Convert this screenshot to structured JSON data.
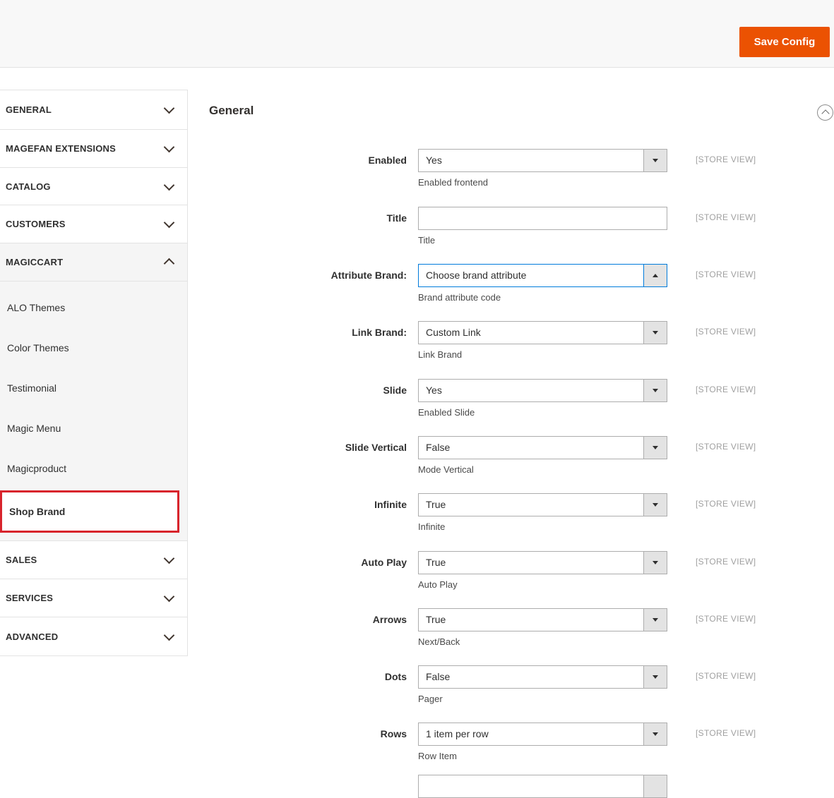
{
  "toolbar": {
    "save_label": "Save Config"
  },
  "sidebar": {
    "sections_above": [
      {
        "label": "GENERAL"
      },
      {
        "label": "MAGEFAN EXTENSIONS"
      },
      {
        "label": "CATALOG"
      },
      {
        "label": "CUSTOMERS"
      }
    ],
    "magiccart": {
      "label": "MAGICCART"
    },
    "subitems": [
      {
        "label": "ALO Themes"
      },
      {
        "label": "Color Themes"
      },
      {
        "label": "Testimonial"
      },
      {
        "label": "Magic Menu"
      },
      {
        "label": "Magicproduct"
      }
    ],
    "selected_subitem": {
      "label": "Shop Brand"
    },
    "sections_below": [
      {
        "label": "SALES"
      },
      {
        "label": "SERVICES"
      },
      {
        "label": "ADVANCED"
      }
    ]
  },
  "main": {
    "section_title": "General",
    "rows": [
      {
        "label": "Enabled",
        "value": "Yes",
        "comment": "Enabled frontend",
        "scope": "[STORE VIEW]"
      },
      {
        "label": "Title",
        "value": "",
        "comment": "Title",
        "scope": "[STORE VIEW]"
      },
      {
        "label": "Attribute Brand:",
        "value": "Choose brand attribute",
        "comment": "Brand attribute code",
        "scope": "[STORE VIEW]"
      },
      {
        "label": "Link Brand:",
        "value": "Custom Link",
        "comment": "Link Brand",
        "scope": "[STORE VIEW]"
      },
      {
        "label": "Slide",
        "value": "Yes",
        "comment": "Enabled Slide",
        "scope": "[STORE VIEW]"
      },
      {
        "label": "Slide Vertical",
        "value": "False",
        "comment": "Mode Vertical",
        "scope": "[STORE VIEW]"
      },
      {
        "label": "Infinite",
        "value": "True",
        "comment": "Infinite",
        "scope": "[STORE VIEW]"
      },
      {
        "label": "Auto Play",
        "value": "True",
        "comment": "Auto Play",
        "scope": "[STORE VIEW]"
      },
      {
        "label": "Arrows",
        "value": "True",
        "comment": "Next/Back",
        "scope": "[STORE VIEW]"
      },
      {
        "label": "Dots",
        "value": "False",
        "comment": "Pager",
        "scope": "[STORE VIEW]"
      },
      {
        "label": "Rows",
        "value": "1 item per row",
        "comment": "Row Item",
        "scope": "[STORE VIEW]"
      }
    ]
  },
  "colors": {
    "accent": "#eb5202",
    "focus_border": "#007bdb",
    "highlight_box": "#d8242c"
  }
}
